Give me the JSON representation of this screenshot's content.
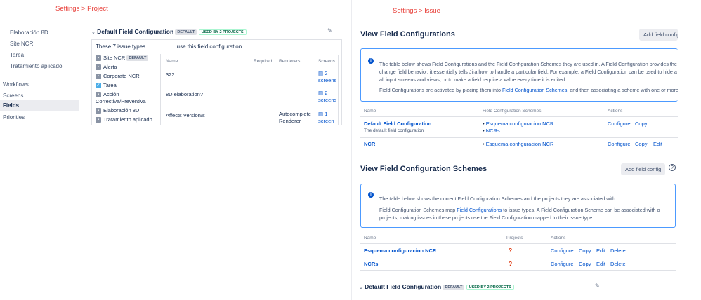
{
  "captions": {
    "left": "Settings > Project",
    "right": "Settings > Issue"
  },
  "left_nav": {
    "sub_items": [
      "Elaboración 8D",
      "Site NCR",
      "Tarea",
      "Tratamiento aplicado"
    ],
    "main_items": [
      "Workflows",
      "Screens",
      "Fields",
      "Priorities"
    ],
    "active": "Fields"
  },
  "left_panel": {
    "title": "Default Field Configuration",
    "badge_default": "DEFAULT",
    "badge_used": "USED BY 2 PROJECTS",
    "types_heading": "These 7 issue types...",
    "use_heading": "...use this field configuration",
    "issue_types": [
      {
        "name": "Site NCR",
        "badge": "DEFAULT",
        "icon": "gray-issue-icon"
      },
      {
        "name": "Alerta",
        "badge": "",
        "icon": "gray-issue-icon"
      },
      {
        "name": "Corporate NCR",
        "badge": "",
        "icon": "gray-issue-icon"
      },
      {
        "name": "Tarea",
        "badge": "",
        "icon": "task-check-icon"
      },
      {
        "name": "Acción Correctiva/Preventiva",
        "badge": "",
        "icon": "gray-issue-icon"
      },
      {
        "name": "Elaboración 8D",
        "badge": "",
        "icon": "gray-issue-icon"
      },
      {
        "name": "Tratamiento aplicado",
        "badge": "",
        "icon": "gray-issue-icon"
      }
    ],
    "columns": {
      "name": "Name",
      "required": "Required",
      "renderers": "Renderers",
      "screens": "Screens"
    },
    "rows": [
      {
        "name": "322",
        "required": "",
        "renderers": "",
        "screens_count": "2",
        "screens_label": "screens"
      },
      {
        "name": "8D elaboration?",
        "required": "",
        "renderers": "",
        "screens_count": "2",
        "screens_label": "screens"
      },
      {
        "name": "Affects Version/s",
        "required": "",
        "renderers": "Autocomplete Renderer",
        "screens_count": "1",
        "screens_label": "screen"
      }
    ]
  },
  "view_fc": {
    "title": "View Field Configurations",
    "add_button": "Add field configuration",
    "info_line1": "The table below shows Field Configurations and the Field Configuration Schemes they are used in. A Field Configuration provides the",
    "info_line2": "change field behavior, it essentially tells Jira how to handle a particular field. For example, a Field Configuration can be used to hide a",
    "info_line3": "all input screens and views, or to make a field require a value every time it is edited.",
    "info_line4_pre": "Field Configurations are activated by placing them into ",
    "info_line4_link": "Field Configuration Schemes",
    "info_line4_post": ", and then associating a scheme with one or more",
    "columns": {
      "name": "Name",
      "schemes": "Field Configuration Schemes",
      "actions": "Actions"
    },
    "rows": [
      {
        "name": "Default Field Configuration",
        "desc": "The default field configuration",
        "schemes": [
          "Esquema configuracion NCR",
          "NCRs"
        ],
        "actions": [
          "Configure",
          "Copy"
        ]
      },
      {
        "name": "NCR",
        "desc": "",
        "schemes": [
          "Esquema configuracion NCR"
        ],
        "actions": [
          "Configure",
          "Copy",
          "Edit"
        ]
      }
    ]
  },
  "view_fcs": {
    "title": "View Field Configuration Schemes",
    "add_button": "Add field config",
    "help_icon": "?",
    "info_line1": "The table below shows the current Field Configuration Schemes and the projects they are associated with.",
    "info_line2_pre": "Field Configuration Schemes map ",
    "info_line2_link": "Field Configurations",
    "info_line2_post": " to issue types. A Field Configuration Scheme can be associated with o",
    "info_line3": "projects, making issues in these projects use the Field Configuration mapped to their issue type.",
    "columns": {
      "name": "Name",
      "projects": "Projects",
      "actions": "Actions"
    },
    "rows": [
      {
        "name": "Esquema configuracion NCR",
        "projects": "?",
        "actions": [
          "Configure",
          "Copy",
          "Edit",
          "Delete"
        ]
      },
      {
        "name": "NCRs",
        "projects": "?",
        "actions": [
          "Configure",
          "Copy",
          "Edit",
          "Delete"
        ]
      }
    ]
  },
  "bottom": {
    "title": "Default Field Configuration",
    "badge_default": "DEFAULT",
    "badge_used": "USED BY 2 PROJECTS"
  },
  "colors": {
    "accent": "#0052cc",
    "caption_red": "#e8403a",
    "info_border": "#4c9aff",
    "required_red": "#de350b"
  }
}
